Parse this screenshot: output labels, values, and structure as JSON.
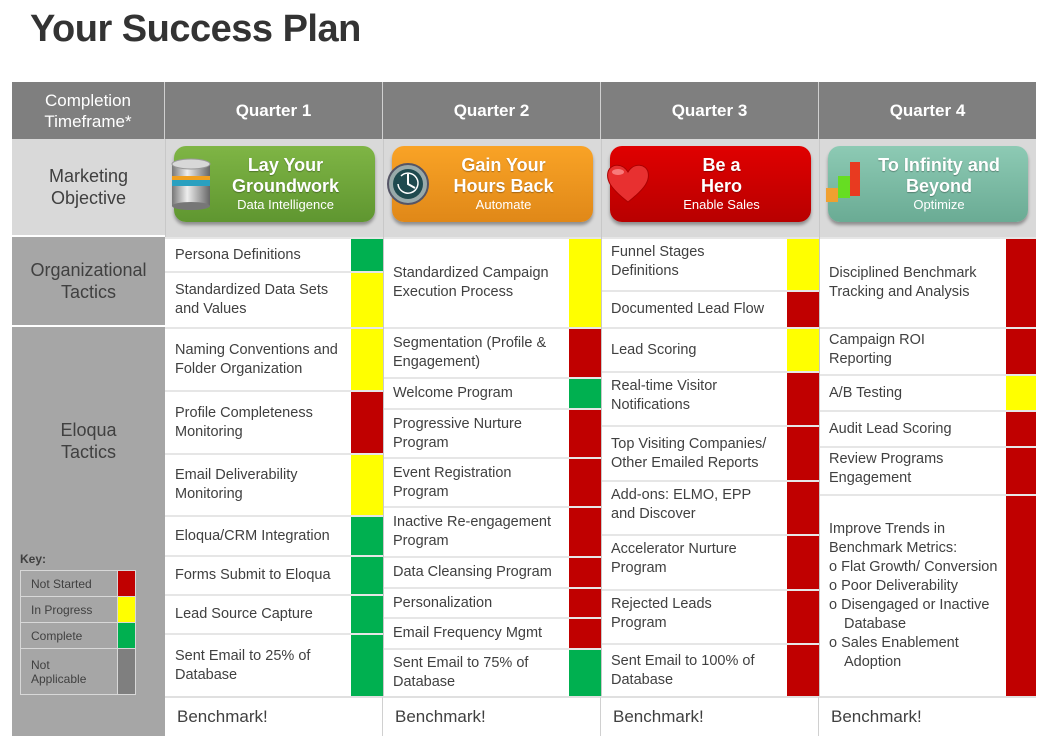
{
  "title": "Your Success Plan",
  "header": {
    "first": "Completion Timeframe*",
    "quarters": [
      "Quarter 1",
      "Quarter 2",
      "Quarter 3",
      "Quarter 4"
    ]
  },
  "row_labels": {
    "objective": "Marketing Objective",
    "org": "Organizational Tactics",
    "eloqua": "Eloqua Tactics"
  },
  "objectives": [
    {
      "line1": "Lay Your",
      "line2": "Groundwork",
      "sub": "Data Intelligence",
      "icon": "database-icon",
      "color": "#6fa63a"
    },
    {
      "line1": "Gain Your",
      "line2": "Hours Back",
      "sub": "Automate",
      "icon": "clock-icon",
      "color": "#f39a1f"
    },
    {
      "line1": "Be a",
      "line2": "Hero",
      "sub": "Enable Sales",
      "icon": "heart-icon",
      "color": "#d00000"
    },
    {
      "line1": "To Infinity and",
      "line2": "Beyond",
      "sub": "Optimize",
      "icon": "bar-chart-icon",
      "color": "#7dbda6"
    }
  ],
  "status_colors": {
    "not_started": "#c00000",
    "in_progress": "#ffff00",
    "complete": "#00b050",
    "not_applicable": "#7f7f7f"
  },
  "key": {
    "label": "Key:",
    "items": [
      {
        "label": "Not Started",
        "status": "not_started"
      },
      {
        "label": "In Progress",
        "status": "in_progress"
      },
      {
        "label": "Complete",
        "status": "complete"
      },
      {
        "label": "Not Applicable",
        "status": "not_applicable"
      }
    ]
  },
  "columns": [
    {
      "org": [
        {
          "text": "Persona Definitions",
          "status": "complete"
        },
        {
          "text": "Standardized Data Sets and Values",
          "status": "in_progress"
        }
      ],
      "eloqua": [
        {
          "text": "Naming Conventions and Folder Organization",
          "status": "in_progress"
        },
        {
          "text": "Profile Completeness Monitoring",
          "status": "not_started"
        },
        {
          "text": "Email Deliverability Monitoring",
          "status": "in_progress"
        },
        {
          "text": "Eloqua/CRM Integration",
          "status": "complete"
        },
        {
          "text": "Forms Submit to Eloqua",
          "status": "complete"
        },
        {
          "text": "Lead Source Capture",
          "status": "complete"
        },
        {
          "text": "Sent Email to 25% of Database",
          "status": "complete"
        }
      ],
      "benchmark": "Benchmark!"
    },
    {
      "org": [
        {
          "text": "Standardized Campaign Execution Process",
          "status": "in_progress"
        }
      ],
      "eloqua": [
        {
          "text": "Segmentation (Profile & Engagement)",
          "status": "not_started"
        },
        {
          "text": "Welcome Program",
          "status": "complete"
        },
        {
          "text": "Progressive Nurture Program",
          "status": "not_started"
        },
        {
          "text": "Event Registration Program",
          "status": "not_started"
        },
        {
          "text": "Inactive Re-engagement Program",
          "status": "not_started"
        },
        {
          "text": "Data Cleansing Program",
          "status": "not_started"
        },
        {
          "text": "Personalization",
          "status": "not_started"
        },
        {
          "text": "Email Frequency Mgmt",
          "status": "not_started"
        },
        {
          "text": "Sent Email to 75% of Database",
          "status": "complete"
        }
      ],
      "benchmark": "Benchmark!"
    },
    {
      "org": [
        {
          "text": "Funnel Stages Definitions",
          "status": "in_progress"
        },
        {
          "text": "Documented Lead Flow",
          "status": "not_started"
        }
      ],
      "eloqua": [
        {
          "text": "Lead Scoring",
          "status": "in_progress"
        },
        {
          "text": "Real-time Visitor Notifications",
          "status": "not_started"
        },
        {
          "text": "Top Visiting Companies/ Other Emailed Reports",
          "status": "not_started"
        },
        {
          "text": "Add-ons: ELMO, EPP and Discover",
          "status": "not_started"
        },
        {
          "text": "Accelerator Nurture Program",
          "status": "not_started"
        },
        {
          "text": "Rejected Leads Program",
          "status": "not_started"
        },
        {
          "text": "Sent Email to 100% of Database",
          "status": "not_started"
        }
      ],
      "benchmark": "Benchmark!"
    },
    {
      "org": [
        {
          "text": "Disciplined Benchmark Tracking and Analysis",
          "status": "not_started"
        }
      ],
      "eloqua": [
        {
          "text": "Campaign ROI Reporting",
          "status": "not_started"
        },
        {
          "text": "A/B Testing",
          "status": "in_progress"
        },
        {
          "text": "Audit Lead Scoring",
          "status": "not_started"
        },
        {
          "text": "Review Programs Engagement",
          "status": "not_started"
        },
        {
          "text": "Improve Trends in Benchmark Metrics:",
          "status": "not_started",
          "bullets": [
            "Flat Growth/ Conversion",
            "Poor Deliverability",
            "Disengaged or Inactive Database",
            "Sales Enablement Adoption"
          ]
        }
      ],
      "benchmark": "Benchmark!"
    }
  ]
}
